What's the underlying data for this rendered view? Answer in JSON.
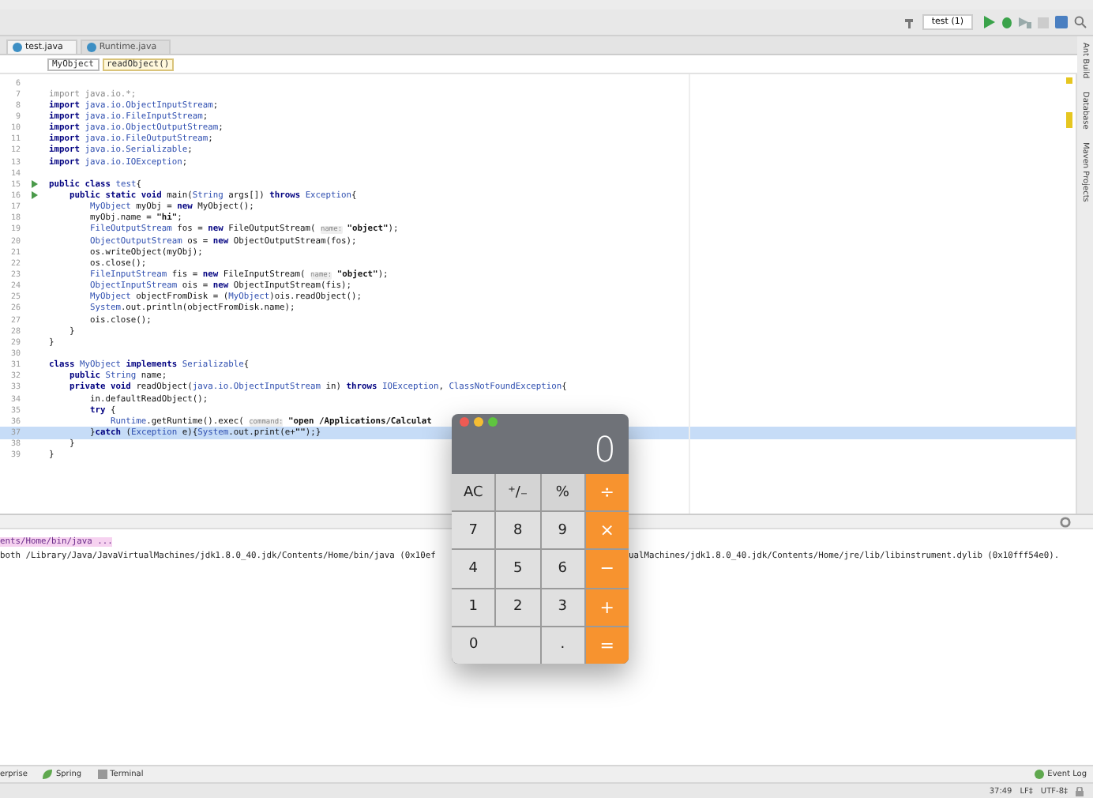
{
  "toolbar": {
    "run_config": "test (1)"
  },
  "tabs": [
    {
      "label": "test.java",
      "selected": true
    },
    {
      "label": "Runtime.java",
      "selected": false
    }
  ],
  "breadcrumb": [
    {
      "label": "MyObject",
      "selected": false
    },
    {
      "label": "readObject()",
      "selected": true
    }
  ],
  "side_tools": [
    "Ant Build",
    "Database",
    "Maven Projects"
  ],
  "code": [
    {
      "no": "6",
      "run": false,
      "selected": false
    },
    {
      "no": "7",
      "run": false,
      "selected": false,
      "segments": [
        {
          "kind": "unused",
          "text": "import java.io.*;"
        }
      ]
    },
    {
      "no": "8",
      "run": false,
      "selected": false,
      "segments": [
        {
          "kind": "kw",
          "text": "import "
        },
        {
          "kind": "type",
          "text": "java.io.ObjectInputStream"
        },
        {
          "kind": "plain",
          "text": ";"
        }
      ]
    },
    {
      "no": "9",
      "run": false,
      "selected": false,
      "segments": [
        {
          "kind": "kw",
          "text": "import "
        },
        {
          "kind": "type",
          "text": "java.io.FileInputStream"
        },
        {
          "kind": "plain",
          "text": ";"
        }
      ]
    },
    {
      "no": "10",
      "run": false,
      "selected": false,
      "segments": [
        {
          "kind": "kw",
          "text": "import "
        },
        {
          "kind": "type",
          "text": "java.io.ObjectOutputStream"
        },
        {
          "kind": "plain",
          "text": ";"
        }
      ]
    },
    {
      "no": "11",
      "run": false,
      "selected": false,
      "segments": [
        {
          "kind": "kw",
          "text": "import "
        },
        {
          "kind": "type",
          "text": "java.io.FileOutputStream"
        },
        {
          "kind": "plain",
          "text": ";"
        }
      ]
    },
    {
      "no": "12",
      "run": false,
      "selected": false,
      "segments": [
        {
          "kind": "kw",
          "text": "import "
        },
        {
          "kind": "type",
          "text": "java.io.Serializable"
        },
        {
          "kind": "plain",
          "text": ";"
        }
      ]
    },
    {
      "no": "13",
      "run": false,
      "selected": false,
      "segments": [
        {
          "kind": "kw",
          "text": "import "
        },
        {
          "kind": "type",
          "text": "java.io.IOException"
        },
        {
          "kind": "plain",
          "text": ";"
        }
      ]
    },
    {
      "no": "14",
      "run": false,
      "selected": false
    },
    {
      "no": "15",
      "run": true,
      "selected": false,
      "segments": [
        {
          "kind": "kw",
          "text": "public class "
        },
        {
          "kind": "type",
          "text": "test"
        },
        {
          "kind": "plain",
          "text": "{"
        }
      ]
    },
    {
      "no": "16",
      "run": true,
      "selected": false,
      "segments": [
        {
          "kind": "kw",
          "text": "    public static void "
        },
        {
          "kind": "plain",
          "text": "main("
        },
        {
          "kind": "type",
          "text": "String"
        },
        {
          "kind": "plain",
          "text": " args[]) "
        },
        {
          "kind": "kw",
          "text": "throws "
        },
        {
          "kind": "type",
          "text": "Exception"
        },
        {
          "kind": "plain",
          "text": "{"
        }
      ]
    },
    {
      "no": "17",
      "run": false,
      "selected": false,
      "segments": [
        {
          "kind": "type",
          "text": "        MyObject"
        },
        {
          "kind": "plain",
          "text": " myObj = "
        },
        {
          "kind": "kw",
          "text": "new "
        },
        {
          "kind": "plain",
          "text": "MyObject();"
        }
      ]
    },
    {
      "no": "18",
      "run": false,
      "selected": false,
      "segments": [
        {
          "kind": "plain",
          "text": "        myObj.name = "
        },
        {
          "kind": "str",
          "text": "\"hi\""
        },
        {
          "kind": "plain",
          "text": ";"
        }
      ]
    },
    {
      "no": "19",
      "run": false,
      "selected": false,
      "segments": [
        {
          "kind": "type",
          "text": "        FileOutputStream"
        },
        {
          "kind": "plain",
          "text": " fos = "
        },
        {
          "kind": "kw",
          "text": "new "
        },
        {
          "kind": "plain",
          "text": "FileOutputStream( "
        },
        {
          "kind": "hint",
          "text": "name:"
        },
        {
          "kind": "str",
          "text": " \"object\""
        },
        {
          "kind": "plain",
          "text": ");"
        }
      ]
    },
    {
      "no": "20",
      "run": false,
      "selected": false,
      "segments": [
        {
          "kind": "type",
          "text": "        ObjectOutputStream"
        },
        {
          "kind": "plain",
          "text": " os = "
        },
        {
          "kind": "kw",
          "text": "new "
        },
        {
          "kind": "plain",
          "text": "ObjectOutputStream(fos);"
        }
      ]
    },
    {
      "no": "21",
      "run": false,
      "selected": false,
      "segments": [
        {
          "kind": "plain",
          "text": "        os.writeObject(myObj);"
        }
      ]
    },
    {
      "no": "22",
      "run": false,
      "selected": false,
      "segments": [
        {
          "kind": "plain",
          "text": "        os.close();"
        }
      ]
    },
    {
      "no": "23",
      "run": false,
      "selected": false,
      "segments": [
        {
          "kind": "type",
          "text": "        FileInputStream"
        },
        {
          "kind": "plain",
          "text": " fis = "
        },
        {
          "kind": "kw",
          "text": "new "
        },
        {
          "kind": "plain",
          "text": "FileInputStream( "
        },
        {
          "kind": "hint",
          "text": "name:"
        },
        {
          "kind": "str",
          "text": " \"object\""
        },
        {
          "kind": "plain",
          "text": ");"
        }
      ]
    },
    {
      "no": "24",
      "run": false,
      "selected": false,
      "segments": [
        {
          "kind": "type",
          "text": "        ObjectInputStream"
        },
        {
          "kind": "plain",
          "text": " ois = "
        },
        {
          "kind": "kw",
          "text": "new "
        },
        {
          "kind": "plain",
          "text": "ObjectInputStream(fis);"
        }
      ]
    },
    {
      "no": "25",
      "run": false,
      "selected": false,
      "segments": [
        {
          "kind": "type",
          "text": "        MyObject"
        },
        {
          "kind": "plain",
          "text": " objectFromDisk = ("
        },
        {
          "kind": "type",
          "text": "MyObject"
        },
        {
          "kind": "plain",
          "text": ")ois.readObject();"
        }
      ]
    },
    {
      "no": "26",
      "run": false,
      "selected": false,
      "segments": [
        {
          "kind": "type",
          "text": "        System"
        },
        {
          "kind": "plain",
          "text": ".out.println(objectFromDisk.name);"
        }
      ]
    },
    {
      "no": "27",
      "run": false,
      "selected": false,
      "segments": [
        {
          "kind": "plain",
          "text": "        ois.close();"
        }
      ]
    },
    {
      "no": "28",
      "run": false,
      "selected": false,
      "segments": [
        {
          "kind": "plain",
          "text": "    }"
        }
      ]
    },
    {
      "no": "29",
      "run": false,
      "selected": false,
      "segments": [
        {
          "kind": "plain",
          "text": "}"
        }
      ]
    },
    {
      "no": "30",
      "run": false,
      "selected": false
    },
    {
      "no": "31",
      "run": false,
      "selected": false,
      "segments": [
        {
          "kind": "kw",
          "text": "class "
        },
        {
          "kind": "type",
          "text": "MyObject "
        },
        {
          "kind": "kw",
          "text": "implements "
        },
        {
          "kind": "type",
          "text": "Serializable"
        },
        {
          "kind": "plain",
          "text": "{"
        }
      ]
    },
    {
      "no": "32",
      "run": false,
      "selected": false,
      "segments": [
        {
          "kind": "kw",
          "text": "    public "
        },
        {
          "kind": "type",
          "text": "String"
        },
        {
          "kind": "plain",
          "text": " name;"
        }
      ]
    },
    {
      "no": "33",
      "run": false,
      "selected": false,
      "segments": [
        {
          "kind": "kw",
          "text": "    private void "
        },
        {
          "kind": "plain",
          "text": "readObject("
        },
        {
          "kind": "type",
          "text": "java.io.ObjectInputStream"
        },
        {
          "kind": "plain",
          "text": " in) "
        },
        {
          "kind": "kw",
          "text": "throws "
        },
        {
          "kind": "type",
          "text": "IOException"
        },
        {
          "kind": "plain",
          "text": ", "
        },
        {
          "kind": "type",
          "text": "ClassNotFoundException"
        },
        {
          "kind": "plain",
          "text": "{"
        }
      ]
    },
    {
      "no": "34",
      "run": false,
      "selected": false,
      "segments": [
        {
          "kind": "plain",
          "text": "        in.defaultReadObject();"
        }
      ]
    },
    {
      "no": "35",
      "run": false,
      "selected": false,
      "segments": [
        {
          "kind": "kw",
          "text": "        try "
        },
        {
          "kind": "plain",
          "text": "{"
        }
      ]
    },
    {
      "no": "36",
      "run": false,
      "selected": false,
      "segments": [
        {
          "kind": "type",
          "text": "            Runtime"
        },
        {
          "kind": "plain",
          "text": ".getRuntime().exec( "
        },
        {
          "kind": "hint",
          "text": "command:"
        },
        {
          "kind": "str",
          "text": " \"open /Applications/Calculat"
        }
      ]
    },
    {
      "no": "37",
      "run": false,
      "selected": true,
      "segments": [
        {
          "kind": "plain",
          "text": "        }"
        },
        {
          "kind": "kw",
          "text": "catch "
        },
        {
          "kind": "plain",
          "text": "("
        },
        {
          "kind": "type",
          "text": "Exception"
        },
        {
          "kind": "plain",
          "text": " e){"
        },
        {
          "kind": "type",
          "text": "System"
        },
        {
          "kind": "plain",
          "text": ".out.print(e+"
        },
        {
          "kind": "str",
          "text": "\"\""
        },
        {
          "kind": "plain",
          "text": ");}"
        }
      ]
    },
    {
      "no": "38",
      "run": false,
      "selected": false,
      "segments": [
        {
          "kind": "plain",
          "text": "    }"
        }
      ]
    },
    {
      "no": "39",
      "run": false,
      "selected": false,
      "segments": [
        {
          "kind": "plain",
          "text": "}"
        }
      ]
    }
  ],
  "run_output": {
    "command": "ents/Home/bin/java ...",
    "line_left": "both /Library/Java/JavaVirtualMachines/jdk1.8.0_40.jdk/Contents/Home/bin/java (0x10ef",
    "line_right": "ualMachines/jdk1.8.0_40.jdk/Contents/Home/jre/lib/libinstrument.dylib (0x10fff54e0)."
  },
  "tool_windows": [
    {
      "label": "erprise",
      "kind": "plain"
    },
    {
      "label": "Spring",
      "kind": "spring"
    },
    {
      "label": "Terminal",
      "kind": "terminal"
    }
  ],
  "event_log": "Event Log",
  "status": [
    "37:49",
    "LF‡",
    "UTF-8‡"
  ],
  "calculator": {
    "display": "0",
    "keys": [
      {
        "label": "AC",
        "kind": "func"
      },
      {
        "label": "⁺∕₋",
        "kind": "func"
      },
      {
        "label": "%",
        "kind": "func"
      },
      {
        "label": "÷",
        "kind": "op"
      },
      {
        "label": "7",
        "kind": "num"
      },
      {
        "label": "8",
        "kind": "num"
      },
      {
        "label": "9",
        "kind": "num"
      },
      {
        "label": "×",
        "kind": "op"
      },
      {
        "label": "4",
        "kind": "num"
      },
      {
        "label": "5",
        "kind": "num"
      },
      {
        "label": "6",
        "kind": "num"
      },
      {
        "label": "−",
        "kind": "op"
      },
      {
        "label": "1",
        "kind": "num"
      },
      {
        "label": "2",
        "kind": "num"
      },
      {
        "label": "3",
        "kind": "num"
      },
      {
        "label": "+",
        "kind": "op"
      },
      {
        "label": "0",
        "kind": "wide"
      },
      {
        "label": ".",
        "kind": "num"
      },
      {
        "label": "=",
        "kind": "op"
      }
    ]
  }
}
